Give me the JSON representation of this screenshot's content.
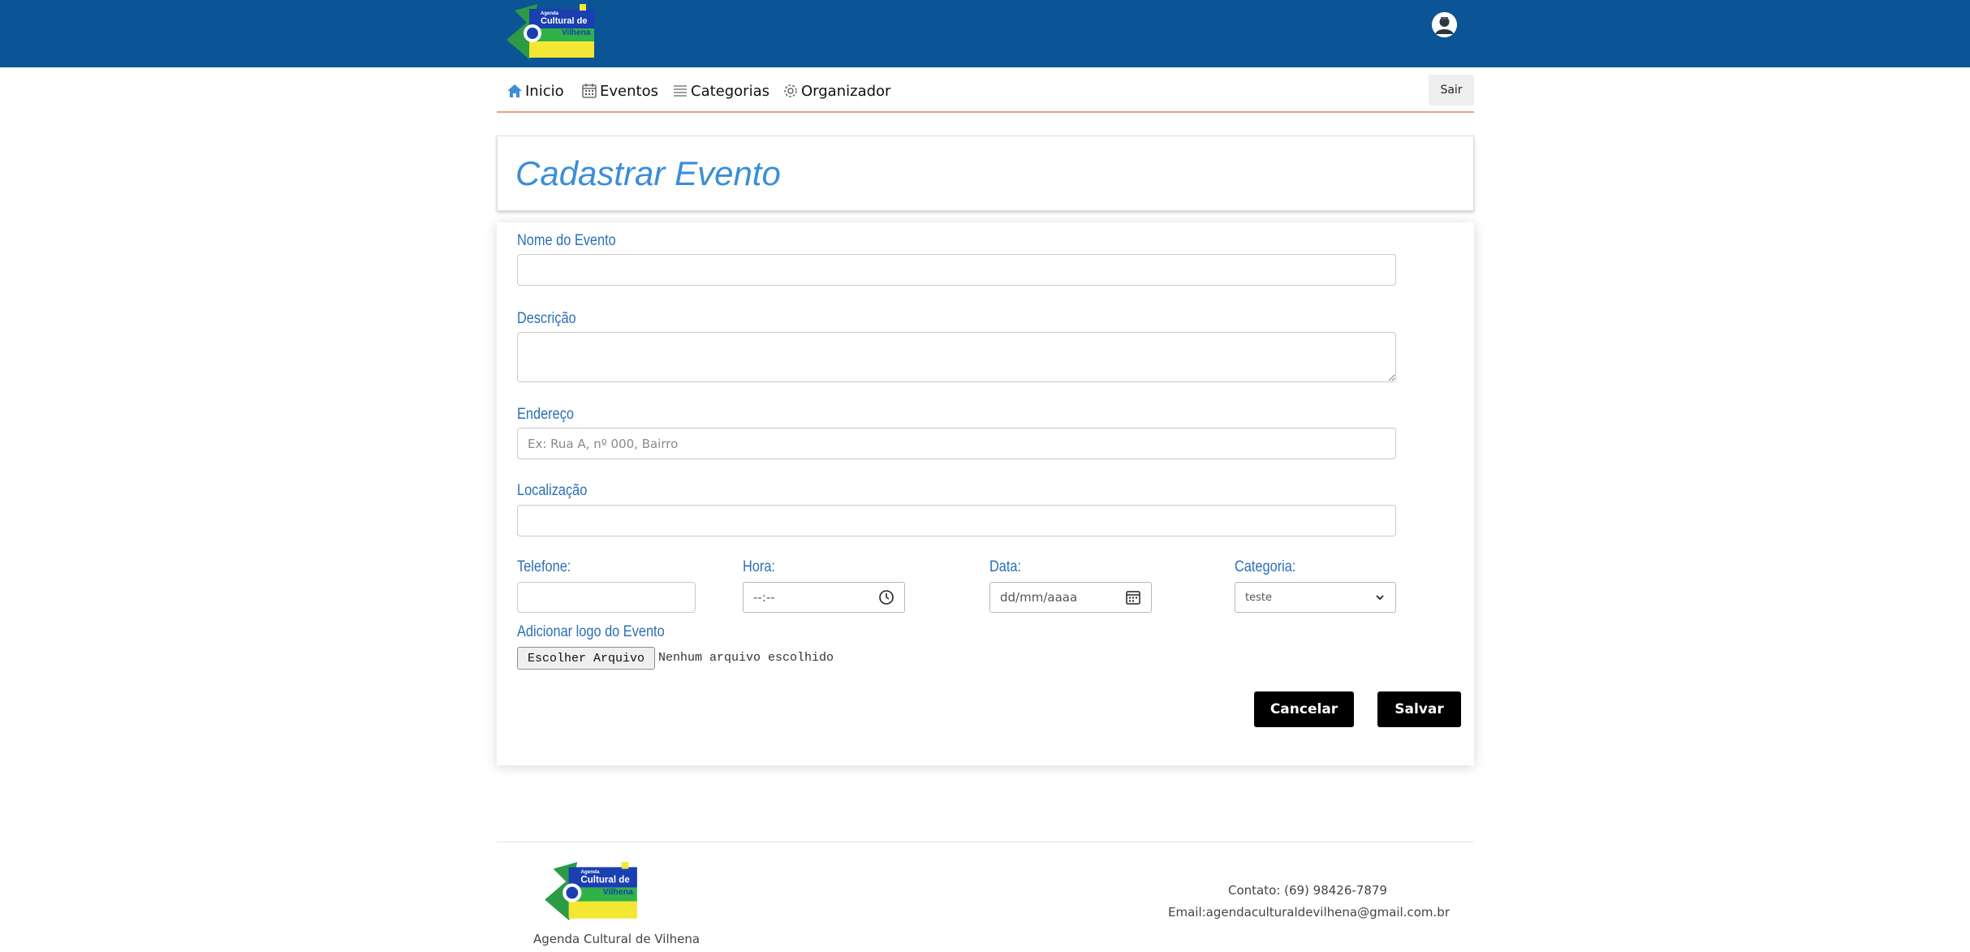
{
  "header": {
    "logo_text": [
      "Agenda",
      "Cultural de",
      "Vilhena"
    ]
  },
  "nav": {
    "items": [
      {
        "label": "Inicio",
        "icon": "home-icon"
      },
      {
        "label": "Eventos",
        "icon": "calendar-icon"
      },
      {
        "label": "Categorias",
        "icon": "list-icon"
      },
      {
        "label": "Organizador",
        "icon": "gear-icon"
      }
    ],
    "logout_label": "Sair"
  },
  "page": {
    "title": "Cadastrar Evento"
  },
  "form": {
    "nome_label": "Nome do Evento",
    "nome_value": "",
    "descricao_label": "Descrição",
    "descricao_value": "",
    "endereco_label": "Endereço",
    "endereco_placeholder": "Ex: Rua A, nº 000, Bairro",
    "localizacao_label": "Localização",
    "localizacao_value": "",
    "telefone_label": "Telefone:",
    "hora_label": "Hora:",
    "hora_placeholder": "--:--",
    "data_label": "Data:",
    "data_placeholder": "dd/mm/aaaa",
    "categoria_label": "Categoria:",
    "categoria_selected": "teste",
    "logo_label": "Adicionar logo do Evento",
    "file_button_label": "Escolher Arquivo",
    "file_status": "Nenhum arquivo escolhido",
    "cancel_label": "Cancelar",
    "save_label": "Salvar"
  },
  "footer": {
    "name": "Agenda Cultural de Vilhena",
    "contact": "Contato: (69) 98426-7879",
    "email": "Email:agendaculturaldevilhena@gmail.com.br"
  },
  "colors": {
    "header_bg": "#0b5596",
    "title": "#3a8ed8",
    "label": "#2a6fb6",
    "nav_underline": "#f0a27a",
    "button": "#000000"
  }
}
